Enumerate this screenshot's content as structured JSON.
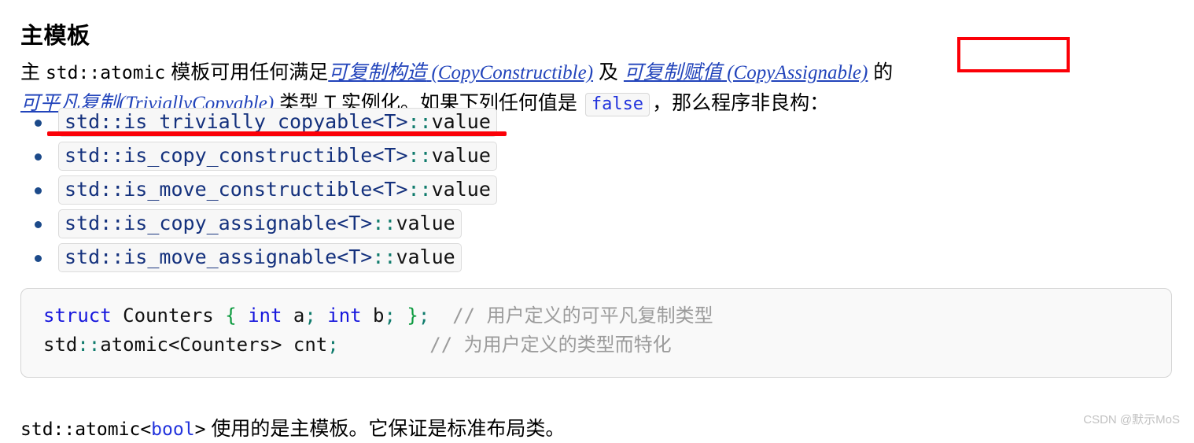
{
  "page": {
    "title": "主模板"
  },
  "intro": {
    "seg1": "主 ",
    "code1": "std::atomic",
    "seg2": " 模板可用任何满足",
    "link1_cjk": "可复制构造",
    "link1_latin": " (CopyConstructible)",
    "seg3": " 及 ",
    "link2_cjk": "可复制赋值",
    "link2_latin": " (CopyAssignable)",
    "seg4": " 的 ",
    "link3_cjk": "可平凡复制",
    "link3_latin": "(TriviallyCopyable)",
    "seg5": " 类型 T 实例化。如果下列任何值是 ",
    "false_badge": "false",
    "seg6": "，那么程序非良构："
  },
  "traits": [
    {
      "ns": "std::is_trivially_copyable",
      "tmpl": "<T>",
      "sep": "::",
      "member": "value",
      "annotated": "red-underline"
    },
    {
      "ns": "std::is_copy_constructible",
      "tmpl": "<T>",
      "sep": "::",
      "member": "value",
      "annotated": ""
    },
    {
      "ns": "std::is_move_constructible",
      "tmpl": "<T>",
      "sep": "::",
      "member": "value",
      "annotated": ""
    },
    {
      "ns": "std::is_copy_assignable",
      "tmpl": "<T>",
      "sep": "::",
      "member": "value",
      "annotated": ""
    },
    {
      "ns": "std::is_move_assignable",
      "tmpl": "<T>",
      "sep": "::",
      "member": "value",
      "annotated": ""
    }
  ],
  "code_block": {
    "line1": {
      "kw1": "struct",
      "name": " Counters ",
      "brace_open": "{",
      "kw2": " int",
      "a": " a",
      "semi1": ";",
      "kw3": " int",
      "b": " b",
      "semi2": ";",
      "brace_close": " }",
      "semi3": ";",
      "comment_slash": "  // ",
      "comment_text": "用户定义的可平凡复制类型"
    },
    "line2": {
      "ns": "std",
      "sep": "::",
      "name": "atomic<Counters> cnt",
      "semi": ";",
      "pad": "        ",
      "comment_slash": "// ",
      "comment_text": "为用户定义的类型而特化"
    }
  },
  "closing": {
    "code_prefix": "std::atomic<",
    "code_kw": "bool",
    "code_suffix": ">",
    "text": " 使用的是主模板。它保证是标准布局类。"
  },
  "watermark": {
    "text": "CSDN @默示MoS"
  },
  "colors": {
    "annotation_red": "#fb0007",
    "link_blue": "#2244bb",
    "code_navy": "#14317d",
    "code_keyword_blue": "#1616dd",
    "code_brace_green": "#0b9a3e",
    "code_sep_teal": "#0f7b6c",
    "comment_gray": "#9b9b9b"
  }
}
